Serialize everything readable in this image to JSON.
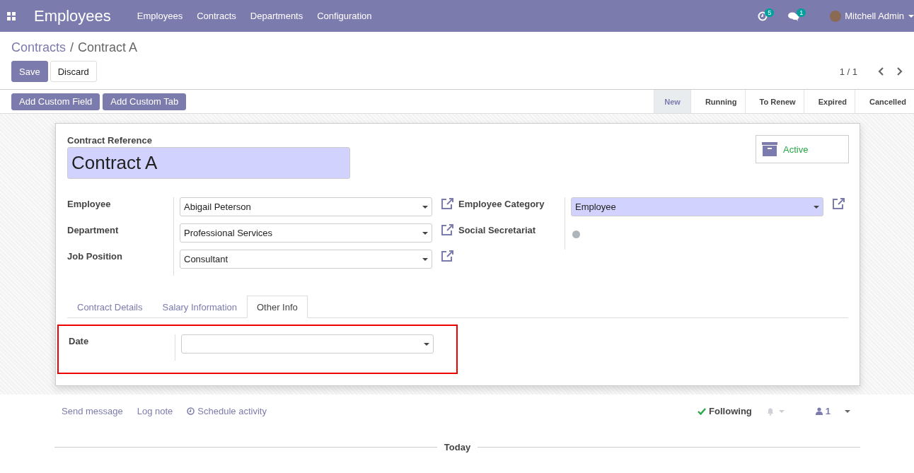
{
  "navbar": {
    "app_title": "Employees",
    "menu": [
      "Employees",
      "Contracts",
      "Departments",
      "Configuration"
    ],
    "activity_count": "5",
    "message_count": "1",
    "user": "Mitchell Admin"
  },
  "breadcrumb": {
    "parent": "Contracts",
    "separator": "/",
    "current": "Contract A"
  },
  "buttons": {
    "save": "Save",
    "discard": "Discard"
  },
  "pager": "1 / 1",
  "studio_buttons": [
    "Add Custom Field",
    "Add Custom Tab"
  ],
  "stages": [
    {
      "label": "New",
      "selected": true
    },
    {
      "label": "Running",
      "selected": false
    },
    {
      "label": "To Renew",
      "selected": false
    },
    {
      "label": "Expired",
      "selected": false
    },
    {
      "label": "Cancelled",
      "selected": false
    }
  ],
  "form": {
    "reference_label": "Contract Reference",
    "reference_value": "Contract A",
    "active_label": "Active",
    "left_fields": [
      {
        "label": "Employee",
        "value": "Abigail Peterson",
        "required": false
      },
      {
        "label": "Department",
        "value": "Professional Services",
        "required": false
      },
      {
        "label": "Job Position",
        "value": "Consultant",
        "required": false
      }
    ],
    "right_fields": [
      {
        "label": "Employee Category",
        "kind": "select",
        "value": "Employee",
        "required": true
      },
      {
        "label": "Social Secretariat",
        "kind": "toggle",
        "on": false
      }
    ],
    "tabs": [
      {
        "label": "Contract Details",
        "selected": false
      },
      {
        "label": "Salary Information",
        "selected": false
      },
      {
        "label": "Other Info",
        "selected": true
      }
    ],
    "tab_fields": [
      {
        "label": "Date",
        "highlighted": true
      }
    ]
  },
  "chatter": {
    "actions": [
      "Send message",
      "Log note",
      "Schedule activity"
    ],
    "following": "Following",
    "followers": "1",
    "divider": "Today"
  }
}
